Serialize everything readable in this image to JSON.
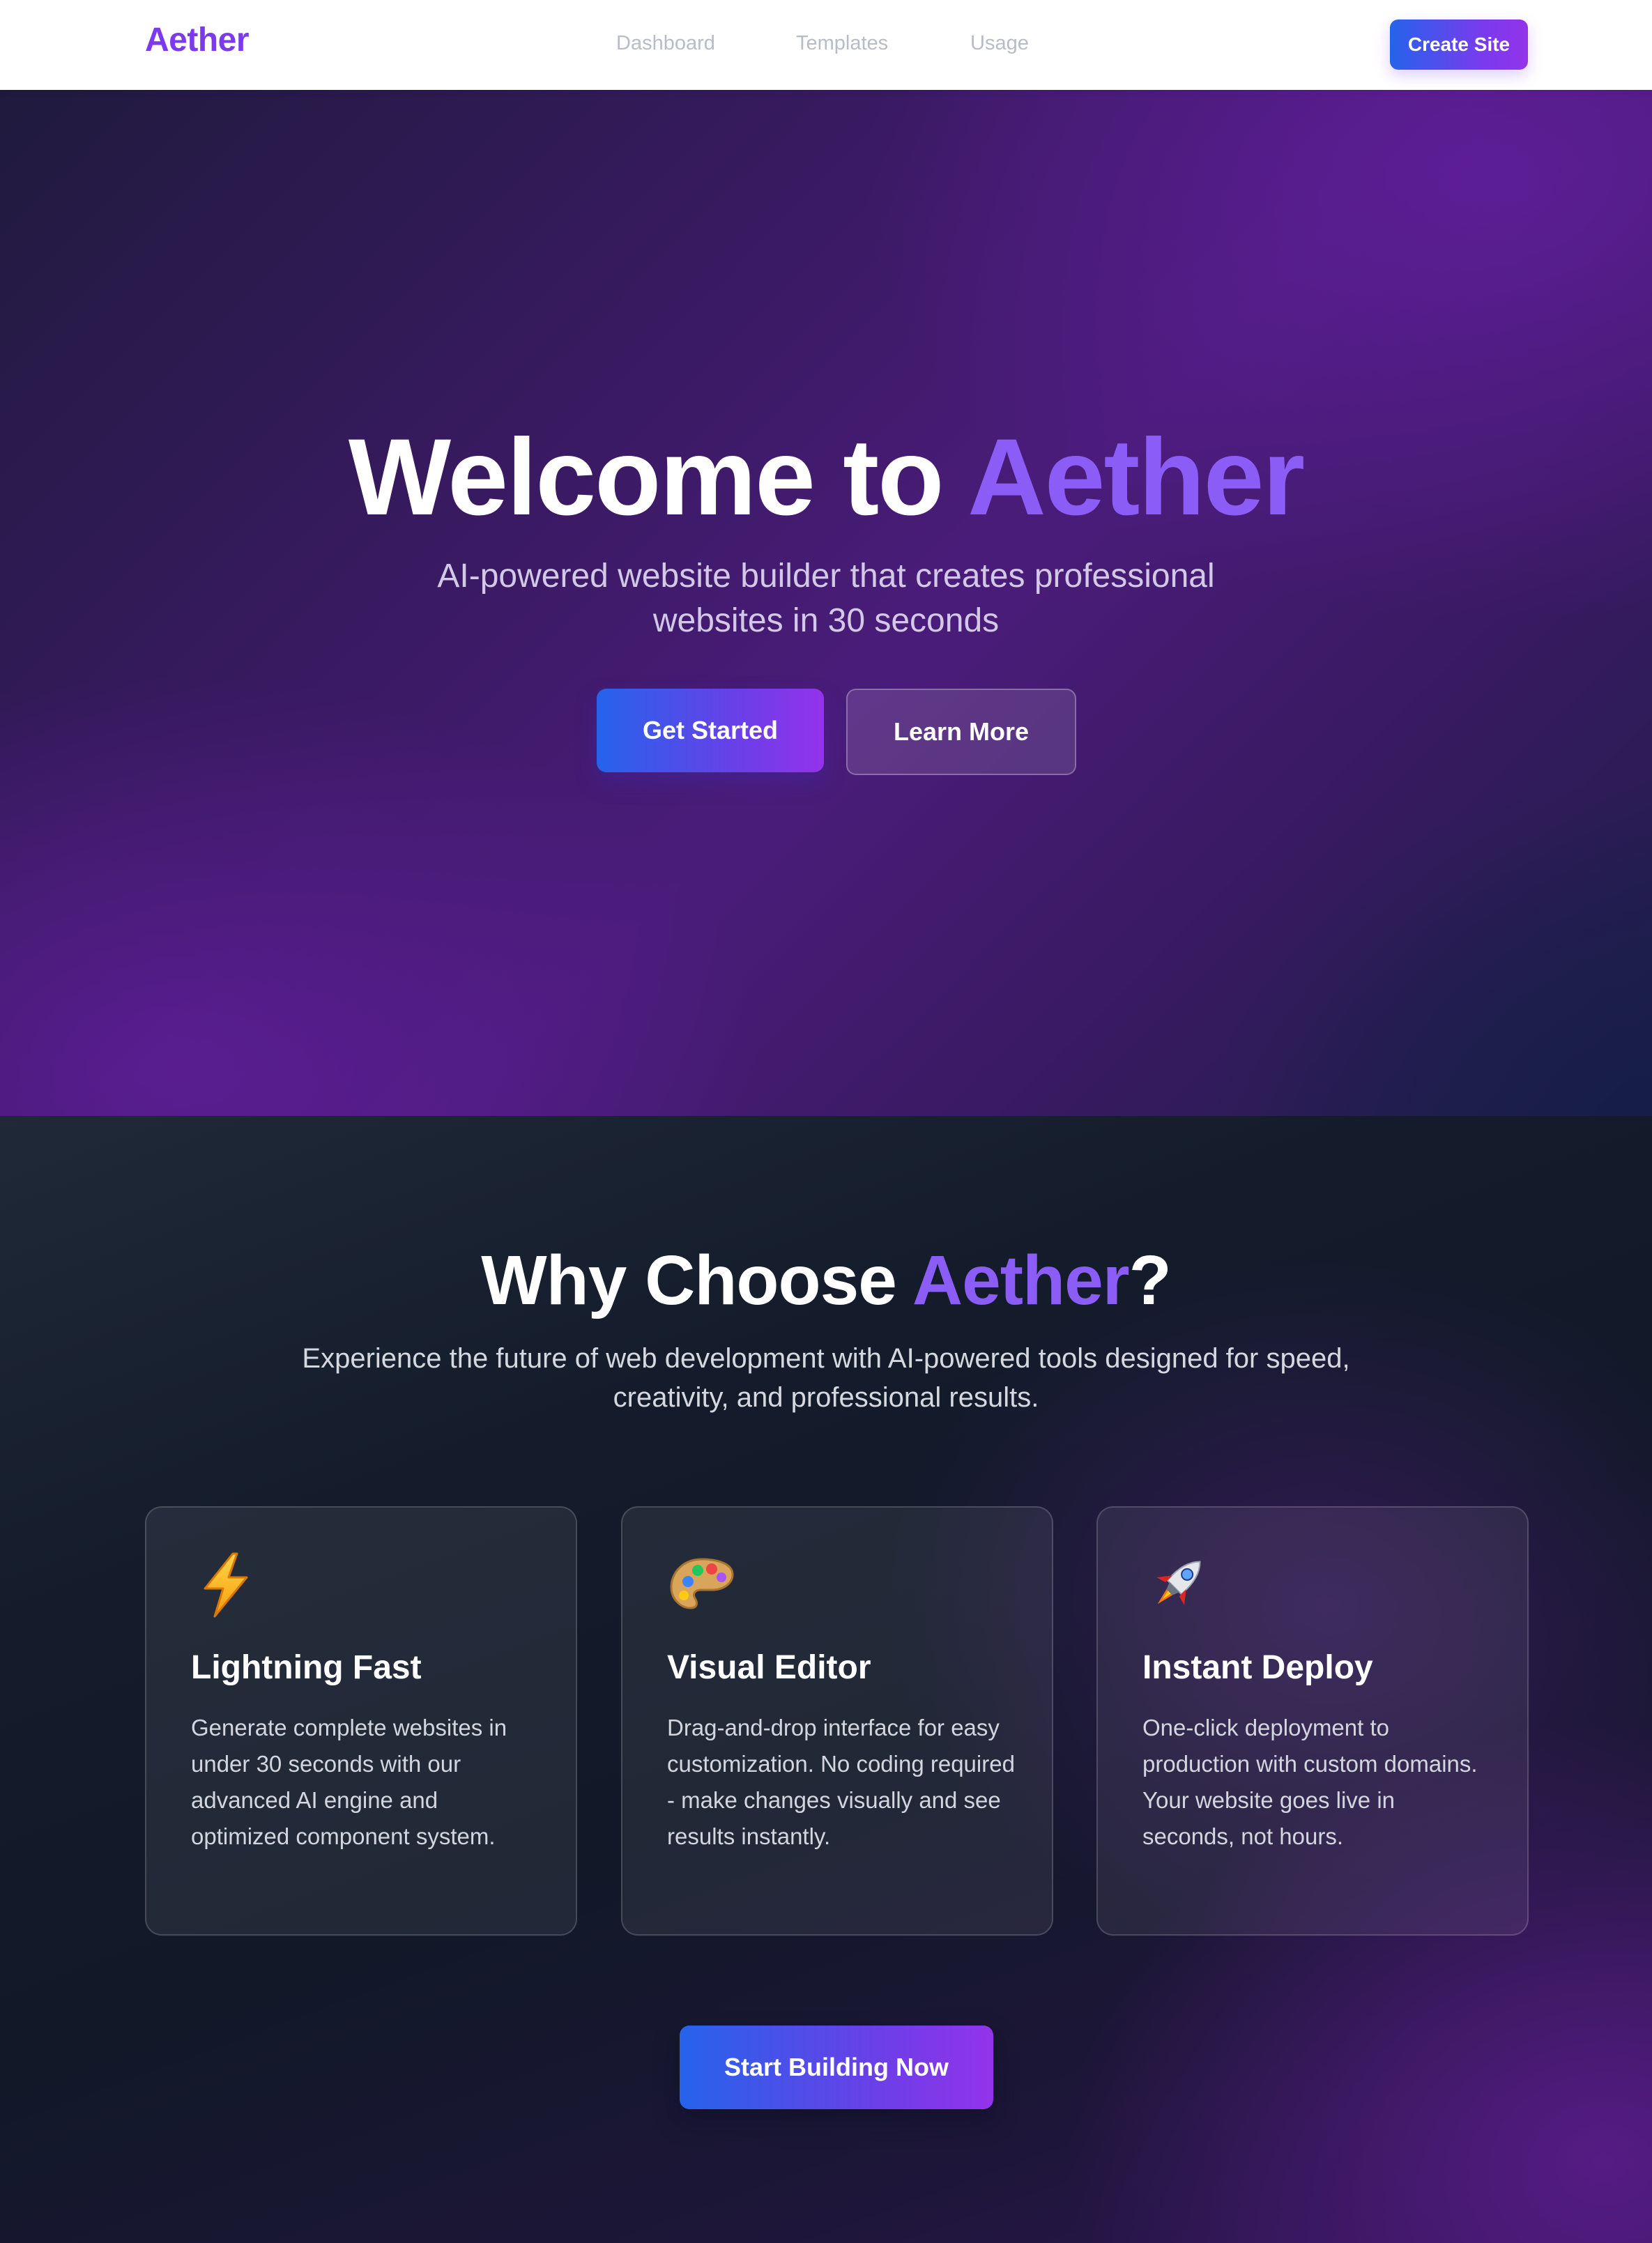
{
  "nav": {
    "brand": "Aether",
    "links": [
      "Dashboard",
      "Templates",
      "Usage"
    ],
    "cta_label": "Create Site"
  },
  "hero": {
    "title_prefix": "Welcome to ",
    "title_accent": "Aether",
    "subtitle": "AI-powered website builder that creates professional websites in 30 seconds",
    "primary_button": "Get Started",
    "secondary_button": "Learn More"
  },
  "features": {
    "title_prefix": "Why Choose ",
    "title_accent": "Aether",
    "title_suffix": "?",
    "subtitle": "Experience the future of web development with AI-powered tools designed for speed, creativity, and professional results.",
    "cards": [
      {
        "icon": "lightning-icon",
        "title": "Lightning Fast",
        "body": "Generate complete websites in under 30 seconds with our advanced AI engine and optimized component system."
      },
      {
        "icon": "palette-icon",
        "title": "Visual Editor",
        "body": "Drag-and-drop interface for easy customization. No coding required - make changes visually and see results instantly."
      },
      {
        "icon": "rocket-icon",
        "title": "Instant Deploy",
        "body": "One-click deployment to production with custom domains. Your website goes live in seconds, not hours."
      }
    ],
    "cta_label": "Start Building Now"
  },
  "colors": {
    "brand": "#7c3aed",
    "accent": "#8b5cf6",
    "gradient_start": "#2563eb",
    "gradient_end": "#9333ea"
  }
}
